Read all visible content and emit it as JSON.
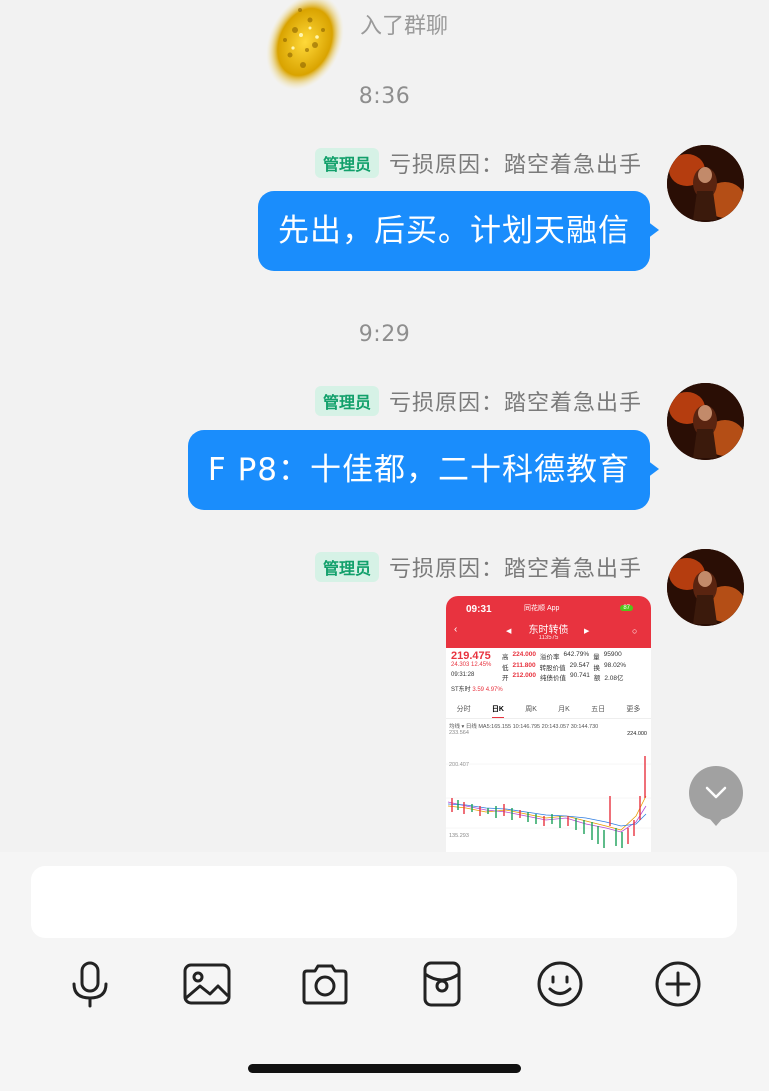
{
  "system_notice": "入了群聊",
  "messages": [
    {
      "time": "8:36",
      "badge": "管理员",
      "nickname": "亏损原因：踏空着急出手",
      "text": "先出，后买。计划天融信"
    },
    {
      "time": "9:29",
      "badge": "管理员",
      "nickname": "亏损原因：踏空着急出手",
      "text": "F P8：十佳都，二十科德教育"
    },
    {
      "badge": "管理员",
      "nickname": "亏损原因：踏空着急出手"
    }
  ],
  "screenshot": {
    "status_time": "09:31",
    "app": "同花顺 App",
    "battery": "87",
    "stock_name": "东时转债",
    "stock_code": "113575",
    "price": "219.475",
    "change": "24.303  12.45%",
    "quote_time": "09:31:28",
    "rows": [
      {
        "l1": "高",
        "v1": "224.000",
        "l2": "溢价率",
        "v2": "642.79%",
        "l3": "量",
        "v3": "95900"
      },
      {
        "l1": "低",
        "v1": "211.800",
        "l2": "转股价值",
        "v2": "29.547",
        "l3": "换",
        "v3": "98.02%"
      },
      {
        "l1": "开",
        "v1": "212.000",
        "l2": "纯债价值",
        "v2": "90.741",
        "l3": "额",
        "v3": "2.08亿"
      }
    ],
    "st_line": {
      "name": "ST东时",
      "price": "3.59",
      "pct": "4.97%"
    },
    "tabs": [
      "分时",
      "日K",
      "周K",
      "月K",
      "五日",
      "更多"
    ],
    "active_tab": "日K",
    "ma_line": "均线 ▾  日线  MA5:165.155  10:146.795  20:143.057  30:144.730",
    "axis": {
      "top": "233.564",
      "high": "224.000",
      "mid": "200.407",
      "bottom": "135.293"
    }
  },
  "input": {
    "placeholder": ""
  },
  "toolbar": [
    "microphone-icon",
    "image-icon",
    "camera-icon",
    "red-packet-icon",
    "emoji-icon",
    "plus-icon"
  ],
  "colors": {
    "bubble": "#1a8dfc",
    "badge_bg": "#d6f2e6",
    "badge_text": "#12a06b",
    "app_red": "#e8333f"
  }
}
